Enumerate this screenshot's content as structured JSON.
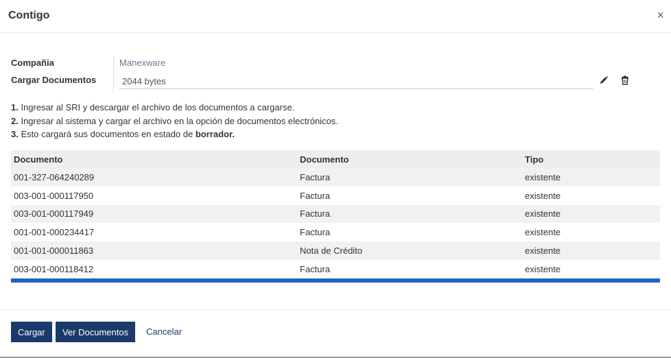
{
  "dialog": {
    "title": "Contigo",
    "close_glyph": "×"
  },
  "form": {
    "company_label": "Compañia",
    "company_value": "Manexware",
    "upload_label": "Cargar Documentos",
    "upload_value": "2044 bytes",
    "edit_icon": "pencil-icon",
    "delete_icon": "trash-icon"
  },
  "instructions": [
    {
      "num": "1.",
      "text": " Ingresar al SRI y descargar el archivo de los documentos a cargarse.",
      "bold": ""
    },
    {
      "num": "2.",
      "text": " Ingresar al sistema y cargar el archivo en la opción de documentos electrónicos.",
      "bold": ""
    },
    {
      "num": "3.",
      "text": " Esto cargará sus documentos en estado de ",
      "bold": "borrador."
    }
  ],
  "table": {
    "headers": [
      "Documento",
      "Documento",
      "Tipo"
    ],
    "rows": [
      [
        "001-327-064240289",
        "Factura",
        "existente"
      ],
      [
        "003-001-000117950",
        "Factura",
        "existente"
      ],
      [
        "003-001-000117949",
        "Factura",
        "existente"
      ],
      [
        "001-001-000234417",
        "Factura",
        "existente"
      ],
      [
        "001-001-000011863",
        "Nota de Crédito",
        "existente"
      ],
      [
        "003-001-000118412",
        "Factura",
        "existente"
      ]
    ]
  },
  "footer": {
    "load_label": "Cargar",
    "view_label": "Ver Documentos",
    "cancel_label": "Cancelar"
  },
  "colors": {
    "primary": "#1a3a6b",
    "progress_bar": "#1f63c7",
    "company_link": "#6c7593"
  }
}
